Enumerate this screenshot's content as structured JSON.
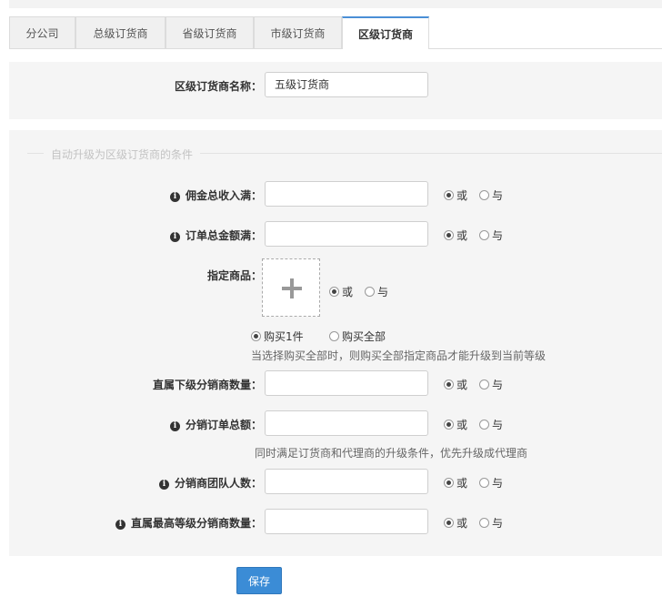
{
  "tabs": [
    {
      "label": "分公司"
    },
    {
      "label": "总级订货商"
    },
    {
      "label": "省级订货商"
    },
    {
      "label": "市级订货商"
    },
    {
      "label": "区级订货商"
    }
  ],
  "name_field": {
    "label": "区级订货商名称：",
    "value": "五级订货商"
  },
  "section_legend": "自动升级为区级订货商的条件",
  "radio_or": "或",
  "radio_and": "与",
  "fields": {
    "commission": {
      "label": "佣金总收入满："
    },
    "order_amount": {
      "label": "订单总金额满："
    },
    "products": {
      "label": "指定商品："
    },
    "direct_count": {
      "label": "直属下级分销商数量："
    },
    "dist_order": {
      "label": "分销订单总额："
    },
    "team_size": {
      "label": "分销商团队人数："
    },
    "top_level_count": {
      "label": "直属最高等级分销商数量："
    }
  },
  "buy_options": {
    "one": "购买1件",
    "all": "购买全部"
  },
  "notes": {
    "buy_all": "当选择购买全部时，则购买全部指定商品才能升级到当前等级",
    "priority": "同时满足订货商和代理商的升级条件，优先升级成代理商"
  },
  "save_label": "保存"
}
